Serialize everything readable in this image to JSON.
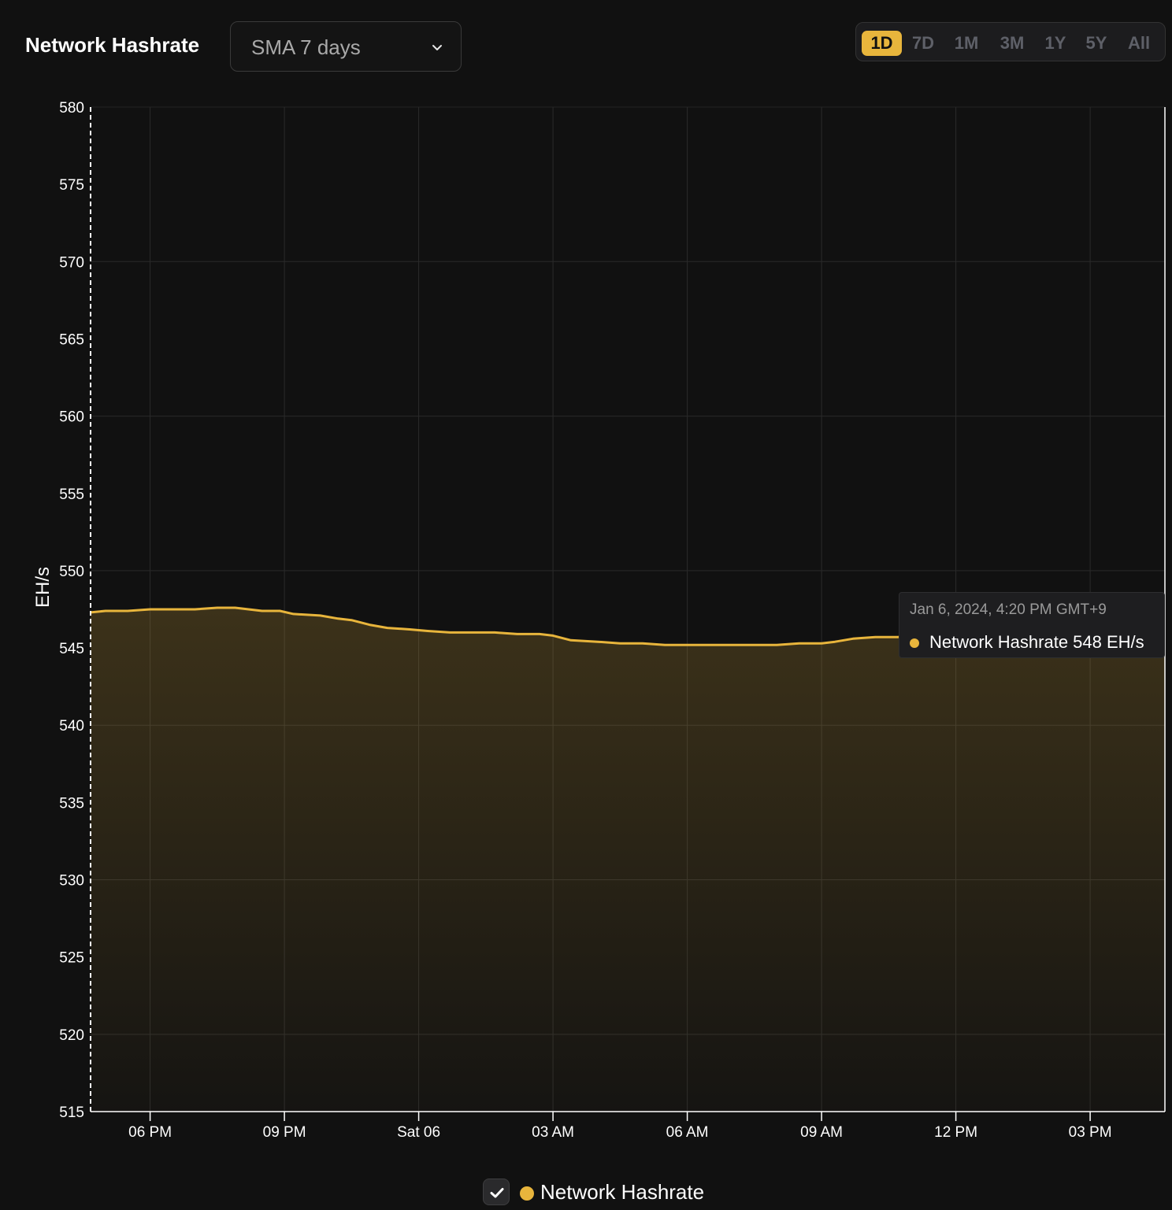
{
  "header": {
    "title": "Network Hashrate",
    "sma_select": {
      "value": "SMA 7 days",
      "icon": "chevron-down-icon"
    },
    "ranges": [
      "1D",
      "7D",
      "1M",
      "3M",
      "1Y",
      "5Y",
      "All"
    ],
    "active_range": "1D"
  },
  "tooltip": {
    "date": "Jan 6, 2024, 4:20 PM GMT+9",
    "series_label": "Network Hashrate 548 EH/s"
  },
  "legend": {
    "label": "Network Hashrate",
    "checked": true,
    "icon": "check-icon"
  },
  "colors": {
    "background": "#111111",
    "accent": "#e8b53c",
    "grid": "#2a2a2a",
    "axis_text": "#ffffff",
    "muted": "#5e6068"
  },
  "chart_data": {
    "type": "area",
    "title": "Network Hashrate",
    "ylabel": "EH/s",
    "xlabel": "",
    "ylim": [
      515,
      580
    ],
    "yticks": [
      515,
      520,
      525,
      530,
      535,
      540,
      545,
      550,
      555,
      560,
      565,
      570,
      575,
      580
    ],
    "xlim": [
      16.67,
      40.67
    ],
    "xticks": [
      {
        "x": 18,
        "label": "06 PM"
      },
      {
        "x": 21,
        "label": "09 PM"
      },
      {
        "x": 24,
        "label": "Sat 06"
      },
      {
        "x": 27,
        "label": "03 AM"
      },
      {
        "x": 30,
        "label": "06 AM"
      },
      {
        "x": 33,
        "label": "09 AM"
      },
      {
        "x": 36,
        "label": "12 PM"
      },
      {
        "x": 39,
        "label": "03 PM"
      }
    ],
    "grid": true,
    "legend_position": "bottom-center",
    "series": [
      {
        "name": "Network Hashrate",
        "color": "#e8b53c",
        "x": [
          16.67,
          17.0,
          17.5,
          18.0,
          18.5,
          19.0,
          19.5,
          19.9,
          20.5,
          20.9,
          21.2,
          21.8,
          22.2,
          22.5,
          22.9,
          23.3,
          23.8,
          24.2,
          24.7,
          25.2,
          25.7,
          26.2,
          26.7,
          27.0,
          27.4,
          28.0,
          28.5,
          29.0,
          29.5,
          30.0,
          30.5,
          31.0,
          31.5,
          32.0,
          32.5,
          33.0,
          33.3,
          33.7,
          34.2,
          34.7,
          35.2,
          35.7,
          36.2,
          36.7,
          37.2,
          37.7,
          38.2,
          38.7,
          39.2,
          39.7,
          40.2,
          40.67
        ],
        "y": [
          547.3,
          547.4,
          547.4,
          547.5,
          547.5,
          547.5,
          547.6,
          547.6,
          547.4,
          547.4,
          547.2,
          547.1,
          546.9,
          546.8,
          546.5,
          546.3,
          546.2,
          546.1,
          546.0,
          546.0,
          546.0,
          545.9,
          545.9,
          545.8,
          545.5,
          545.4,
          545.3,
          545.3,
          545.2,
          545.2,
          545.2,
          545.2,
          545.2,
          545.2,
          545.3,
          545.3,
          545.4,
          545.6,
          545.7,
          545.7,
          545.8,
          545.9,
          546.0,
          546.0,
          546.1,
          546.2,
          546.2,
          546.3,
          546.4,
          546.5,
          546.6,
          546.7
        ]
      }
    ]
  }
}
